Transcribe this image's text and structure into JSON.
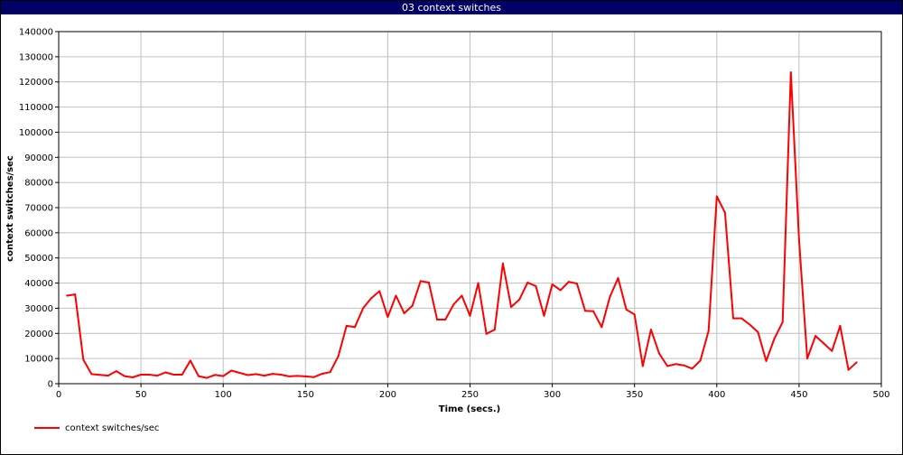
{
  "window": {
    "title": "03 context switches"
  },
  "chart_data": {
    "type": "line",
    "title": "03 context switches",
    "xlabel": "Time (secs.)",
    "ylabel": "context switches/sec",
    "xlim": [
      0,
      500
    ],
    "ylim": [
      0,
      140000
    ],
    "x_ticks": [
      0,
      50,
      100,
      150,
      200,
      250,
      300,
      350,
      400,
      450,
      500
    ],
    "y_ticks": [
      0,
      10000,
      20000,
      30000,
      40000,
      50000,
      60000,
      70000,
      80000,
      90000,
      100000,
      110000,
      120000,
      130000,
      140000
    ],
    "grid": true,
    "legend_position": "bottom-left",
    "series": [
      {
        "name": "context switches/sec",
        "color": "#ff0000",
        "x": [
          5,
          10,
          15,
          20,
          25,
          30,
          35,
          40,
          45,
          50,
          55,
          60,
          65,
          70,
          75,
          80,
          85,
          90,
          95,
          100,
          105,
          110,
          115,
          120,
          125,
          130,
          135,
          140,
          145,
          150,
          155,
          160,
          165,
          170,
          175,
          180,
          185,
          190,
          195,
          200,
          205,
          210,
          215,
          220,
          225,
          230,
          235,
          240,
          245,
          250,
          255,
          260,
          265,
          270,
          275,
          280,
          285,
          290,
          295,
          300,
          305,
          310,
          315,
          320,
          325,
          330,
          335,
          340,
          345,
          350,
          355,
          360,
          365,
          370,
          375,
          380,
          385,
          390,
          395,
          400,
          405,
          410,
          415,
          420,
          425,
          430,
          435,
          440,
          445,
          450,
          455,
          460,
          465,
          470,
          475,
          480,
          485
        ],
        "y": [
          35000,
          35500,
          9500,
          3800,
          3500,
          3200,
          5000,
          3000,
          2500,
          3600,
          3600,
          3200,
          4500,
          3600,
          3600,
          9200,
          3000,
          2300,
          3500,
          3000,
          5200,
          4300,
          3400,
          3800,
          3200,
          3900,
          3600,
          2900,
          3100,
          2900,
          2600,
          3900,
          4600,
          11000,
          23000,
          22500,
          30000,
          34000,
          36800,
          26500,
          35000,
          28000,
          31000,
          40800,
          40200,
          25500,
          25500,
          31500,
          35000,
          27000,
          40000,
          19800,
          21500,
          47800,
          30500,
          33500,
          40200,
          38800,
          27000,
          39500,
          37200,
          40500,
          39800,
          29000,
          28800,
          22500,
          34500,
          42000,
          29500,
          27500,
          7000,
          21500,
          12000,
          7000,
          7800,
          7300,
          6000,
          9200,
          21000,
          74500,
          68000,
          26000,
          26000,
          23500,
          20500,
          9000,
          18000,
          24500,
          123800,
          57000,
          10000,
          19000,
          16000,
          13000,
          23000,
          5500,
          8500
        ]
      }
    ]
  }
}
